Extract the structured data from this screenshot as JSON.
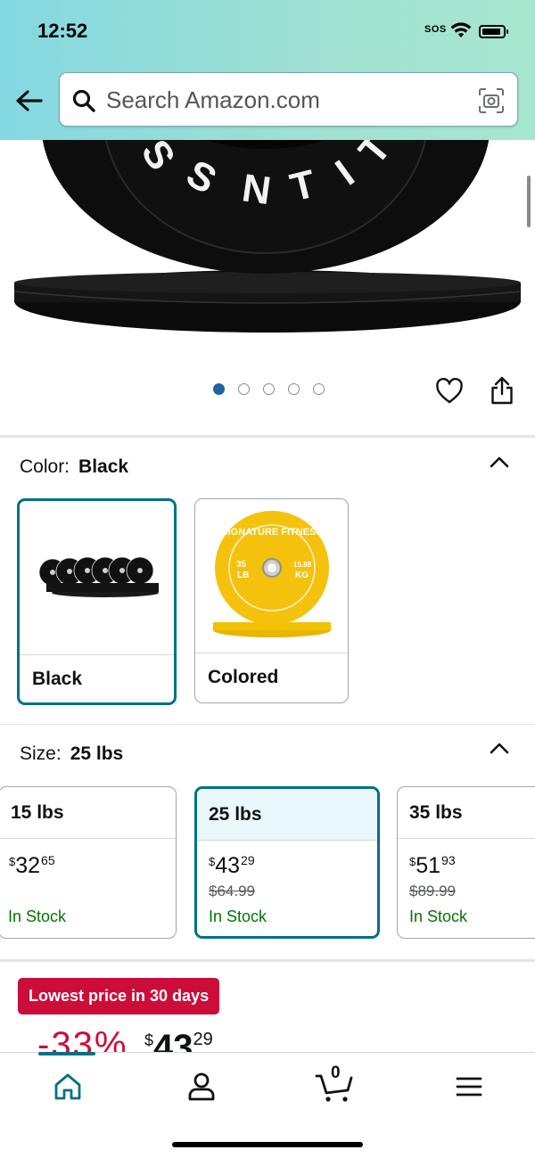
{
  "status_bar": {
    "time": "12:52",
    "sos": "SOS"
  },
  "search": {
    "placeholder": "Search Amazon.com"
  },
  "product_image": {
    "brand_text": "FITNESS",
    "pages": 5,
    "active_page": 1
  },
  "color": {
    "label": "Color:",
    "selected": "Black",
    "options": [
      {
        "label": "Black",
        "selected": true
      },
      {
        "label": "Colored",
        "selected": false
      }
    ],
    "colored_plate_text": {
      "ring": "SIGNATURE FITNESS",
      "lb": "35",
      "lb_unit": "LB",
      "kg": "15.88",
      "kg_unit": "KG"
    }
  },
  "size": {
    "label": "Size:",
    "selected": "25 lbs",
    "options": [
      {
        "label": "15 lbs",
        "currency": "$",
        "whole": "32",
        "cents": "65",
        "was": "",
        "stock": "In Stock",
        "selected": false
      },
      {
        "label": "25 lbs",
        "currency": "$",
        "whole": "43",
        "cents": "29",
        "was": "$64.99",
        "stock": "In Stock",
        "selected": true
      },
      {
        "label": "35 lbs",
        "currency": "$",
        "whole": "51",
        "cents": "93",
        "was": "$89.99",
        "stock": "In Stock",
        "selected": false
      }
    ]
  },
  "deal": {
    "badge": "Lowest price in 30 days",
    "discount": "-33%",
    "currency": "$",
    "whole": "43",
    "cents": "29"
  },
  "bottom_nav": {
    "items": [
      "home-icon",
      "account-icon",
      "cart-icon",
      "menu-icon"
    ],
    "cart_count": "0"
  },
  "colors": {
    "accent": "#007185",
    "deal_red": "#cc0c39",
    "stock_green": "#007600",
    "dot_active": "#2162a1"
  }
}
